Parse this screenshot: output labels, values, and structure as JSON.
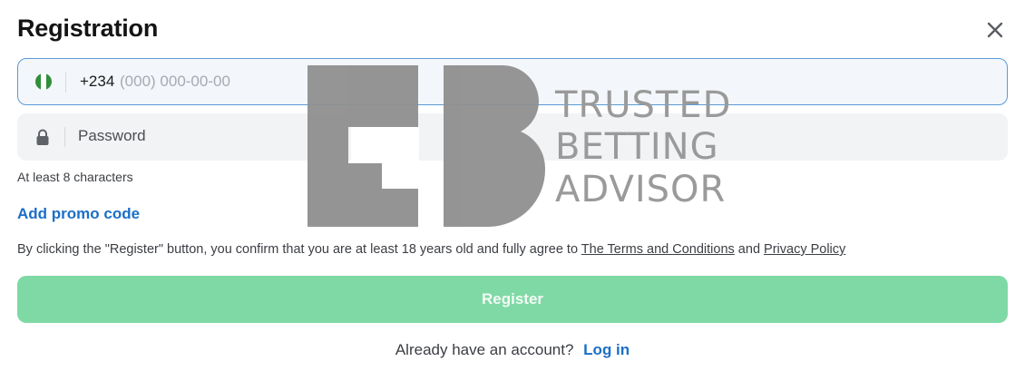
{
  "dialog": {
    "title": "Registration",
    "close_icon": "close-icon"
  },
  "phone": {
    "flag_icon": "nigeria-flag-icon",
    "country_code": "+234",
    "placeholder": "(000) 000-00-00"
  },
  "password": {
    "lock_icon": "lock-icon",
    "placeholder": "Password",
    "hint": "At least 8 characters"
  },
  "promo": {
    "label": "Add promo code"
  },
  "terms": {
    "prefix": "By clicking the \"Register\" button, you confirm that you are at least 18 years old and fully agree to ",
    "terms_link": "The Terms and Conditions",
    "joiner": " and ",
    "privacy_link": "Privacy Policy"
  },
  "register": {
    "label": "Register"
  },
  "login": {
    "prompt": "Already have an account?",
    "link": "Log in"
  },
  "watermark": {
    "line1": "TRUSTED",
    "line2": "BETTING",
    "line3": "ADVISOR"
  },
  "colors": {
    "accent_blue": "#1b6fc7",
    "register_green": "#7fd9a5",
    "focus_border": "#5b9bd5"
  }
}
